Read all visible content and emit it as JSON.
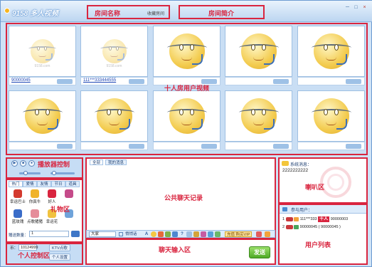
{
  "app": {
    "logo_text": "9158 多人视频",
    "window_controls": [
      "－",
      "□",
      "×"
    ],
    "room_name_label": "房间名称",
    "favorite_label": "收藏房间",
    "room_intro_label": "房间简介"
  },
  "video": {
    "annotation": "十人房用户视频",
    "tiles": [
      {
        "username": "90000045",
        "faded": true,
        "watermark": "9158.com"
      },
      {
        "username": "111***333444555",
        "faded": true,
        "watermark": "9158.com"
      },
      {
        "username": "",
        "faded": false,
        "watermark": ""
      },
      {
        "username": "",
        "faded": false,
        "watermark": ""
      },
      {
        "username": "",
        "faded": false,
        "watermark": ""
      },
      {
        "username": "",
        "faded": false,
        "watermark": ""
      },
      {
        "username": "",
        "faded": false,
        "watermark": ""
      },
      {
        "username": "",
        "faded": false,
        "watermark": ""
      },
      {
        "username": "",
        "faded": false,
        "watermark": ""
      },
      {
        "username": "",
        "faded": false,
        "watermark": ""
      }
    ]
  },
  "player": {
    "annotation": "播放器控制",
    "buttons": [
      "▶",
      "■",
      "●"
    ]
  },
  "gifts": {
    "annotation": "礼物区",
    "tabs": [
      "热门",
      "爱情",
      "友情",
      "节日",
      "道具"
    ],
    "items": [
      {
        "label": "幸运巴士",
        "color": "#d33a2e"
      },
      {
        "label": "你真牛",
        "color": "#f0b32b"
      },
      {
        "label": "好人",
        "color": "#d9253f"
      },
      {
        "label": "",
        "color": "#c54b8a"
      },
      {
        "label": "蓝玫瑰",
        "color": "#3a6cc8"
      },
      {
        "label": "点歌猪猪",
        "color": "#e58d9a"
      },
      {
        "label": "幸运花",
        "color": "#f1c23f"
      },
      {
        "label": "",
        "color": "#6fa3da"
      }
    ],
    "quantity_label": "赠送数量：",
    "quantity_value": "1"
  },
  "personal": {
    "annotation": "个人控制区",
    "coins_label": "币：",
    "coins_value": "10124999",
    "ktv_label": "KTV点歌",
    "settings_label": "个人设置"
  },
  "chat": {
    "annotation": "公共聊天记录",
    "tabs": [
      "全部",
      "我的消息"
    ],
    "target": "大家",
    "mode": "悄悄话",
    "input_annotation": "聊天输入区",
    "send_label": "发送",
    "toolbar_extra": "充值 购买VIP"
  },
  "speaker": {
    "annotation": "喇叭区",
    "system_label": "系统消息：",
    "message": "2222222222"
  },
  "userlist": {
    "annotation": "用户列表",
    "title": "参与用户：",
    "users": [
      {
        "index": "1",
        "name": "111***333",
        "tag": "十人",
        "extra": "90000003"
      },
      {
        "index": "2",
        "name": "90000045",
        "tag": "",
        "extra": "( 90000045 )"
      }
    ]
  }
}
